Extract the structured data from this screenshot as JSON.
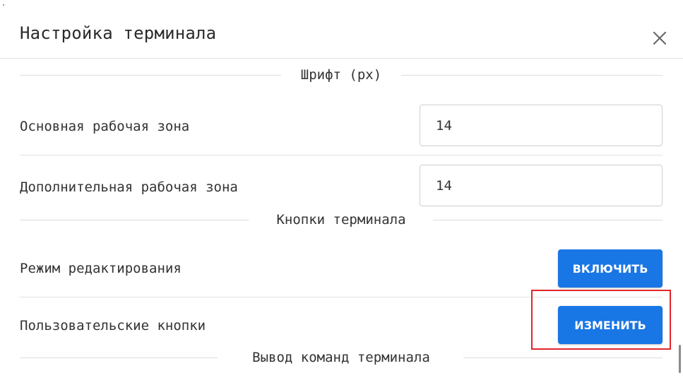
{
  "dialog": {
    "title": "Настройка терминала",
    "close_icon": "close-icon"
  },
  "font_section": {
    "heading": "Шрифт (px)",
    "main_area_label": "Основная рабочая зона",
    "main_area_value": "14",
    "secondary_area_label": "Дополнительная рабочая зона",
    "secondary_area_value": "14"
  },
  "buttons_section": {
    "heading": "Кнопки терминала",
    "edit_mode_label": "Режим редактирования",
    "edit_mode_button": "ВКЛЮЧИТЬ",
    "custom_buttons_label": "Пользовательские кнопки",
    "custom_buttons_button": "ИЗМЕНИТЬ"
  },
  "output_section": {
    "heading": "Вывод команд терминала"
  },
  "colors": {
    "accent": "#1976e5",
    "highlight": "#e0252b",
    "text": "#333333",
    "divider": "#dcdcdc"
  }
}
